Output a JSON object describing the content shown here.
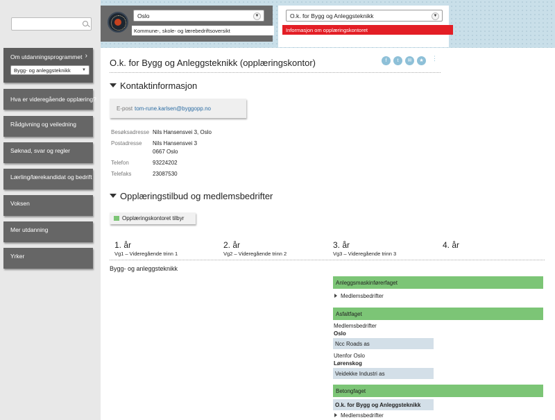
{
  "search": {
    "placeholder": ""
  },
  "sidebar": {
    "program_label": "Om utdanningsprogrammet",
    "program_selected": "Bygg- og anleggsteknikk",
    "items": [
      {
        "label": "Hva er videregående opplæring?"
      },
      {
        "label": "Rådgivning og veiledning"
      },
      {
        "label": "Søknad, svar og regler"
      },
      {
        "label": "Lærling/lærekandidat og bedrift"
      },
      {
        "label": "Voksen"
      },
      {
        "label": "Mer utdanning"
      },
      {
        "label": "Yrker"
      }
    ]
  },
  "header": {
    "county_selected": "Oslo",
    "county_subtitle": "Kommune-, skole- og lærebedriftsoversikt",
    "office_selected": "O.k. for Bygg og Anleggsteknikk",
    "office_subtitle": "Informasjon om opplæringskontoret"
  },
  "main": {
    "title": "O.k. for Bygg og Anleggsteknikk (opplæringskontor)",
    "share_icons": [
      "facebook-icon",
      "twitter-icon",
      "email-icon",
      "favorite-icon",
      "more-icon"
    ],
    "contact": {
      "heading": "Kontaktinformasjon",
      "email_label": "E-post",
      "email": "tom-rune.karlsen@byggopp.no",
      "rows": [
        {
          "label": "Besøksadresse",
          "value": "Nils Hansensvei 3, Oslo"
        },
        {
          "label": "Postadresse",
          "value": "Nils Hansensvei 3"
        },
        {
          "label": "",
          "value": "0667 Oslo"
        },
        {
          "label": "Telefon",
          "value": "93224202"
        },
        {
          "label": "Telefaks",
          "value": "23087530"
        }
      ]
    },
    "offers": {
      "heading": "Opplæringstilbud og medlemsbedrifter",
      "legend_label": "Opplæringskontoret tilbyr",
      "legend_color": "#7cc576",
      "years": [
        {
          "number": "1. år",
          "stage": "Vg1 – Videregående trinn 1"
        },
        {
          "number": "2. år",
          "stage": "Vg2 – Videregående trinn 2"
        },
        {
          "number": "3. år",
          "stage": "Vg3 – Videregående trinn 3"
        },
        {
          "number": "4. år",
          "stage": ""
        }
      ],
      "program": "Bygg- og anleggsteknikk",
      "subjects": {
        "s1": {
          "name": "Anleggsmaskinførerfaget",
          "expander": "Medlemsbedrifter"
        },
        "s2": {
          "name": "Asfaltfaget",
          "members_label": "Medlemsbedrifter",
          "groups": [
            {
              "region": "",
              "place": "Oslo",
              "company": "Ncc Roads as"
            },
            {
              "region": "Utenfor Oslo",
              "place": "Lørenskog",
              "company": "Veidekke Industri as"
            }
          ]
        },
        "s3": {
          "name": "Betongfaget",
          "company": "O.k. for Bygg og Anleggsteknikk",
          "expander": "Medlemsbedrifter"
        }
      }
    }
  }
}
